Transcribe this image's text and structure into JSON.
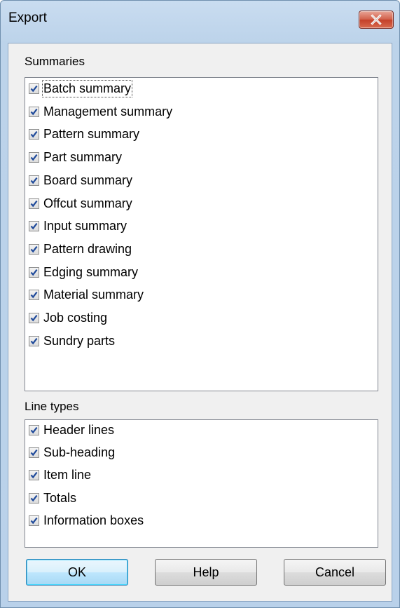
{
  "window": {
    "title": "Export"
  },
  "summaries": {
    "label": "Summaries",
    "items": [
      {
        "label": "Batch summary",
        "checked": true
      },
      {
        "label": "Management summary",
        "checked": true
      },
      {
        "label": "Pattern summary",
        "checked": true
      },
      {
        "label": "Part summary",
        "checked": true
      },
      {
        "label": "Board summary",
        "checked": true
      },
      {
        "label": "Offcut summary",
        "checked": true
      },
      {
        "label": "Input summary",
        "checked": true
      },
      {
        "label": "Pattern drawing",
        "checked": true
      },
      {
        "label": "Edging summary",
        "checked": true
      },
      {
        "label": "Material summary",
        "checked": true
      },
      {
        "label": "Job costing",
        "checked": true
      },
      {
        "label": "Sundry parts",
        "checked": true
      }
    ]
  },
  "line_types": {
    "label": "Line types",
    "items": [
      {
        "label": "Header lines",
        "checked": true
      },
      {
        "label": "Sub-heading",
        "checked": true
      },
      {
        "label": "Item line",
        "checked": true
      },
      {
        "label": "Totals",
        "checked": true
      },
      {
        "label": "Information boxes",
        "checked": true
      }
    ]
  },
  "buttons": {
    "ok": "OK",
    "help": "Help",
    "cancel": "Cancel"
  },
  "colors": {
    "title_bar": "#c9dcf0",
    "close_button": "#c4402a",
    "checkmark": "#1f4a9a"
  }
}
